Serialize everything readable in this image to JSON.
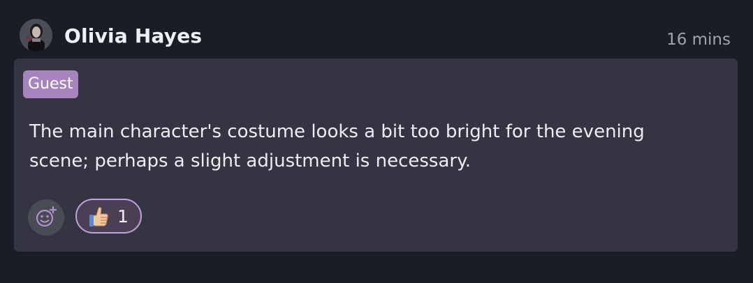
{
  "comment": {
    "author": "Olivia Hayes",
    "timestamp": "16 mins",
    "role_badge": "Guest",
    "text": "The main character's costume looks a bit too bright for the evening scene; perhaps a slight adjustment is necessary.",
    "reactions": [
      {
        "emoji": "thumbs-up-icon",
        "count": "1"
      }
    ]
  },
  "colors": {
    "page_bg": "#1b1d26",
    "card_bg": "#353443",
    "badge_bg": "#a784bd",
    "reaction_border": "#c2a3e0",
    "timestamp": "#9ea3ad"
  },
  "icons": {
    "avatar": "user-avatar",
    "add_reaction": "add-emoji-icon"
  }
}
